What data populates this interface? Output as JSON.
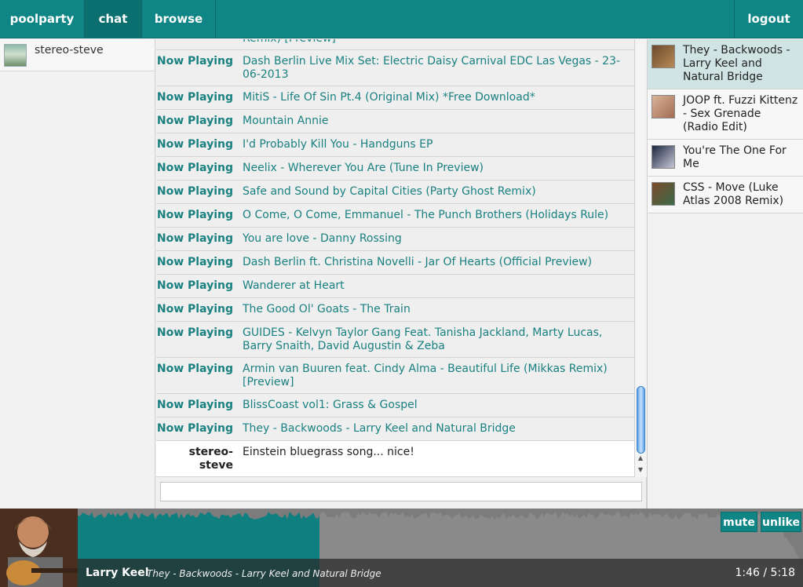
{
  "nav": {
    "brand": "poolparty",
    "chat": "chat",
    "browse": "browse",
    "logout": "logout"
  },
  "users": [
    {
      "name": "stereo-steve"
    }
  ],
  "chat": {
    "messages": [
      {
        "who": "Now Playing",
        "text": "Armin van Buuren feat. Cindy Alma - Beautiful Life (Protoculture Remix) [Preview]",
        "type": "np"
      },
      {
        "who": "Now Playing",
        "text": "Dash Berlin Live Mix Set: Electric Daisy Carnival EDC Las Vegas - 23-06-2013",
        "type": "np"
      },
      {
        "who": "Now Playing",
        "text": "MitiS - Life Of Sin Pt.4 (Original Mix) *Free Download*",
        "type": "np"
      },
      {
        "who": "Now Playing",
        "text": "Mountain Annie",
        "type": "np"
      },
      {
        "who": "Now Playing",
        "text": "I'd Probably Kill You - Handguns EP",
        "type": "np"
      },
      {
        "who": "Now Playing",
        "text": "Neelix - Wherever You Are (Tune In Preview)",
        "type": "np"
      },
      {
        "who": "Now Playing",
        "text": "Safe and Sound by Capital Cities (Party Ghost Remix)",
        "type": "np"
      },
      {
        "who": "Now Playing",
        "text": "O Come, O Come, Emmanuel - The Punch Brothers (Holidays Rule)",
        "type": "np"
      },
      {
        "who": "Now Playing",
        "text": "You are love - Danny Rossing",
        "type": "np"
      },
      {
        "who": "Now Playing",
        "text": "Dash Berlin ft. Christina Novelli - Jar Of Hearts (Official Preview)",
        "type": "np"
      },
      {
        "who": "Now Playing",
        "text": "Wanderer at Heart",
        "type": "np"
      },
      {
        "who": "Now Playing",
        "text": "The Good Ol' Goats - The Train",
        "type": "np"
      },
      {
        "who": "Now Playing",
        "text": "GUIDES - Kelvyn Taylor Gang Feat. Tanisha Jackland, Marty Lucas, Barry Snaith, David Augustin & Zeba",
        "type": "np"
      },
      {
        "who": "Now Playing",
        "text": "Armin van Buuren feat. Cindy Alma - Beautiful Life (Mikkas Remix) [Preview]",
        "type": "np"
      },
      {
        "who": "Now Playing",
        "text": "BlissCoast vol1: Grass & Gospel",
        "type": "np"
      },
      {
        "who": "Now Playing",
        "text": "They - Backwoods - Larry Keel and Natural Bridge",
        "type": "np"
      },
      {
        "who": "stereo-steve",
        "text": "Einstein bluegrass song... nice!",
        "type": "chat"
      }
    ],
    "input_placeholder": ""
  },
  "queue": [
    {
      "title": "They - Backwoods - Larry Keel and Natural Bridge",
      "active": true,
      "art_colors": [
        "#6a4a2c",
        "#b98a58"
      ]
    },
    {
      "title": "JOOP ft. Fuzzi Kittenz - Sex Grenade (Radio Edit)",
      "active": false,
      "art_colors": [
        "#d8b59a",
        "#a36b52"
      ]
    },
    {
      "title": "You're The One For Me",
      "active": false,
      "art_colors": [
        "#1c2740",
        "#c8c8d6"
      ]
    },
    {
      "title": "CSS - Move (Luke Atlas 2008 Remix)",
      "active": false,
      "art_colors": [
        "#7a4a2a",
        "#3c6a4a"
      ]
    }
  ],
  "player": {
    "artist": "Larry Keel",
    "track": "They - Backwoods - Larry Keel and Natural Bridge",
    "time": "1:46 / 5:18",
    "progress": 0.333,
    "mute_label": "mute",
    "unlike_label": "unlike",
    "played_color": "#0f7f7f",
    "unplayed_color": "#8a8a8a"
  },
  "colors": {
    "accent": "#0f8585",
    "now_playing_text": "#1a8080"
  }
}
